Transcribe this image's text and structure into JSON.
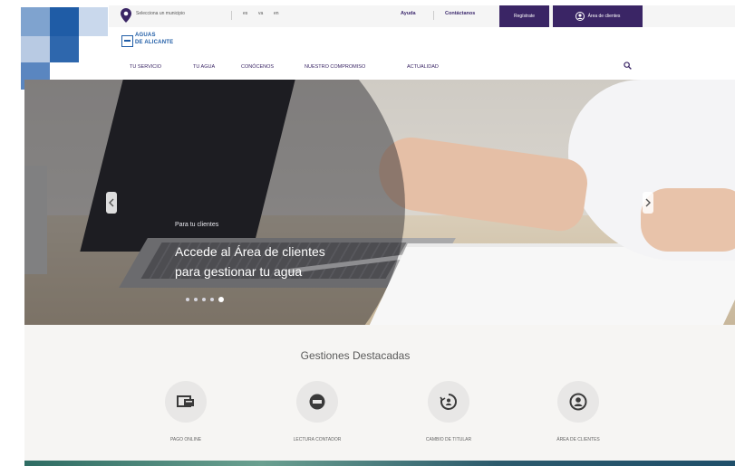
{
  "topbar": {
    "municipality_label": "Selecciona un municipio",
    "languages": [
      "es",
      "va",
      "en"
    ],
    "ayuda": "Ayuda",
    "contactanos": "Contáctanos",
    "register": "Regístrate",
    "client_area": "Área de clientes"
  },
  "logo": {
    "line1": "AGUAS",
    "line2": "DE ALICANTE"
  },
  "nav": [
    "TU SERVICIO",
    "TU AGUA",
    "CONÓCENOS",
    "NUESTRO COMPROMISO",
    "ACTUALIDAD"
  ],
  "hero": {
    "kicker": "Para tu clientes",
    "title_line1": "Accede al Área de clientes",
    "title_line2": "para gestionar tu agua",
    "slides": 5,
    "active_slide": 5
  },
  "gestiones": {
    "title": "Gestiones Destacadas",
    "items": [
      {
        "label": "PAGO ONLINE",
        "icon": "card-payment-icon"
      },
      {
        "label": "LECTURA CONTADOR",
        "icon": "water-meter-icon"
      },
      {
        "label": "CAMBIO DE TITULAR",
        "icon": "change-owner-icon"
      },
      {
        "label": "ÁREA DE CLIENTES",
        "icon": "user-icon"
      }
    ]
  },
  "colors": {
    "brand_purple": "#3a2565",
    "brand_blue": "#1f5ca6"
  }
}
